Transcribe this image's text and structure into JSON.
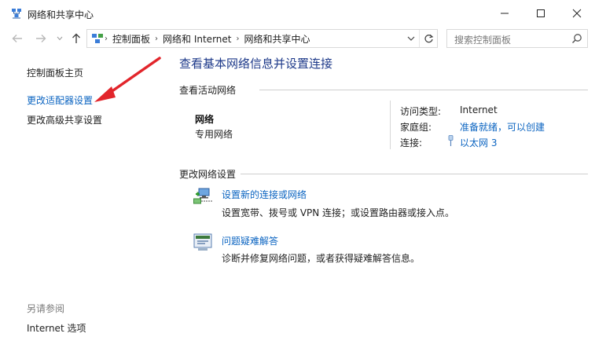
{
  "window": {
    "title": "网络和共享中心"
  },
  "address_bar": {
    "crumbs": [
      "控制面板",
      "网络和 Internet",
      "网络和共享中心"
    ]
  },
  "search": {
    "placeholder": "搜索控制面板"
  },
  "left_nav": {
    "home": "控制面板主页",
    "adapter_settings": "更改适配器设置",
    "advanced_sharing": "更改高级共享设置",
    "see_also_header": "另请参阅",
    "internet_options": "Internet 选项"
  },
  "main": {
    "title": "查看基本网络信息并设置连接",
    "active_networks_header": "查看活动网络",
    "network": {
      "name": "网络",
      "profile": "专用网络",
      "access_type_label": "访问类型:",
      "access_type_value": "Internet",
      "homegroup_label": "家庭组:",
      "homegroup_value": "准备就绪，可以创建",
      "connections_label": "连接:",
      "connections_value": "以太网 3"
    },
    "change_settings_header": "更改网络设置",
    "tasks": [
      {
        "title": "设置新的连接或网络",
        "description": "设置宽带、拨号或 VPN 连接；或设置路由器或接入点。"
      },
      {
        "title": "问题疑难解答",
        "description": "诊断并修复网络问题，或者获得疑难解答信息。"
      }
    ]
  },
  "colors": {
    "link": "#0b64c1",
    "title_blue": "#1e3a8a",
    "annotation_arrow": "#e2252b"
  }
}
